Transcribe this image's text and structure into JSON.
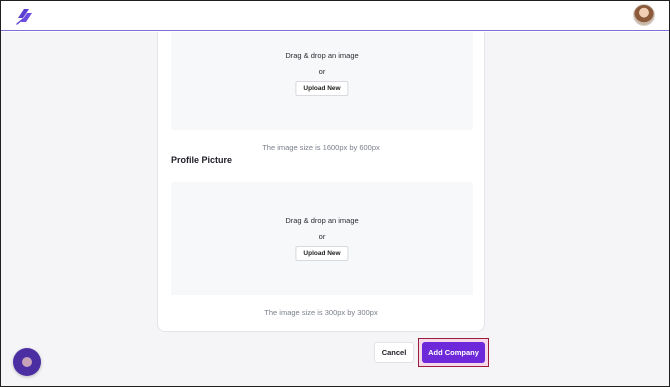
{
  "header": {
    "logo_icon": "feather-logo-icon",
    "avatar_icon": "user-avatar"
  },
  "cover_upload": {
    "drag_text": "Drag & drop an image",
    "or_text": "or",
    "upload_label": "Upload New",
    "size_hint": "The image size is 1600px by 600px"
  },
  "profile_picture": {
    "label": "Profile Picture",
    "drag_text": "Drag & drop an image",
    "or_text": "or",
    "upload_label": "Upload New",
    "size_hint": "The image size is 300px by 300px"
  },
  "footer": {
    "cancel_label": "Cancel",
    "add_label": "Add Company"
  },
  "help_widget": {
    "icon": "chat-help-icon"
  },
  "colors": {
    "accent": "#6d28d9",
    "highlight_border": "#9c1d3a",
    "topbar_rule": "#7c6fd6"
  }
}
